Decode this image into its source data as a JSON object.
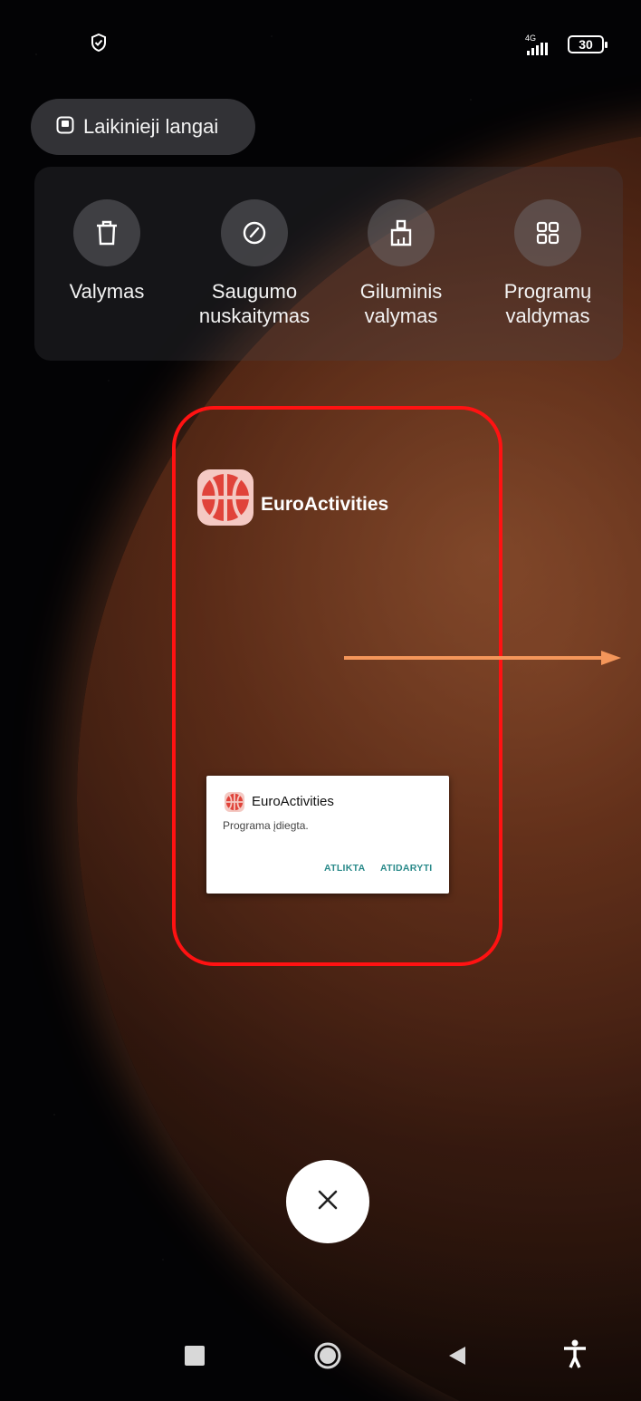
{
  "status_bar": {
    "network": "4G",
    "battery": "30"
  },
  "floating_windows": {
    "label": "Laikinieji langai"
  },
  "tools": [
    {
      "label": "Valymas",
      "icon": "trash-icon"
    },
    {
      "label": "Saugumo nuskaitymas",
      "icon": "gauge-icon"
    },
    {
      "label": "Giluminis valymas",
      "icon": "brush-icon"
    },
    {
      "label": "Programų valdymas",
      "icon": "grid-icon"
    }
  ],
  "recent_app": {
    "title": "EuroActivities",
    "dialog": {
      "title": "EuroActivities",
      "message": "Programa įdiegta.",
      "done_label": "ATLIKTA",
      "open_label": "ATIDARYTI"
    }
  },
  "colors": {
    "highlight": "#ff1212",
    "arrow": "#f4965a",
    "dialog_button": "#2a8a8a",
    "app_icon_bg": "#f4c9c3",
    "app_icon_fg": "#e0433a"
  }
}
